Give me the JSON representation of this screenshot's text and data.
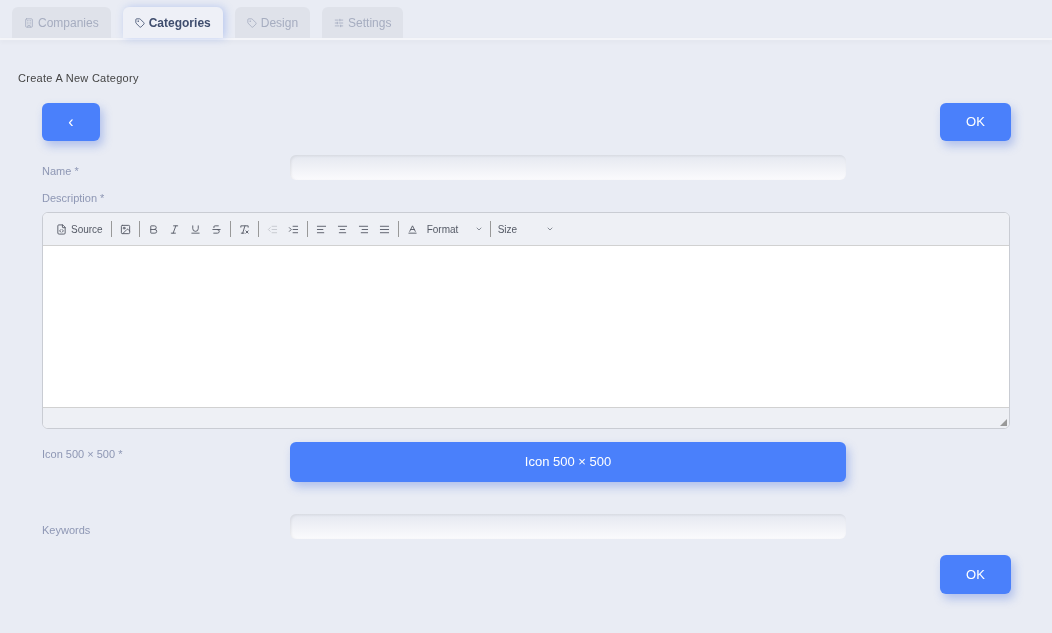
{
  "tabs": [
    {
      "label": "Companies",
      "kind": "building",
      "selected": false
    },
    {
      "label": "Categories",
      "kind": "tag",
      "selected": true
    },
    {
      "label": "Design",
      "kind": "tag",
      "selected": false
    },
    {
      "label": "Settings",
      "kind": "sliders",
      "selected": false
    }
  ],
  "page_title": "Create A New Category",
  "back_button": "‹",
  "ok_button_top": "OK",
  "fields": [
    {
      "kind": "input",
      "label": "Name *"
    },
    {
      "kind": "editor",
      "label": "Description *",
      "toolbar": [
        [
          {
            "kind": "source",
            "label": "Source",
            "disabled": false
          }
        ],
        [
          {
            "kind": "image",
            "disabled": false
          }
        ],
        [
          {
            "kind": "bold",
            "disabled": false
          },
          {
            "kind": "italic",
            "disabled": false
          },
          {
            "kind": "underline",
            "disabled": false
          },
          {
            "kind": "strike",
            "disabled": false
          }
        ],
        [
          {
            "kind": "clear",
            "disabled": false
          }
        ],
        [
          {
            "kind": "outdent",
            "disabled": true
          },
          {
            "kind": "indent",
            "disabled": false
          }
        ],
        [
          {
            "kind": "align-left",
            "disabled": false
          },
          {
            "kind": "align-center",
            "disabled": false
          },
          {
            "kind": "align-right",
            "disabled": false
          },
          {
            "kind": "justify",
            "disabled": false
          }
        ],
        [
          {
            "kind": "color",
            "disabled": false
          },
          {
            "kind": "dropdown",
            "label": "Format",
            "disabled": false
          }
        ],
        [
          {
            "kind": "dropdown",
            "label": "Size",
            "disabled": false
          }
        ]
      ]
    },
    {
      "kind": "upload",
      "label": "Icon 500 × 500 *",
      "button": "Icon 500 × 500"
    },
    {
      "kind": "input",
      "label": "Keywords"
    }
  ],
  "ok_button_bottom": "OK"
}
